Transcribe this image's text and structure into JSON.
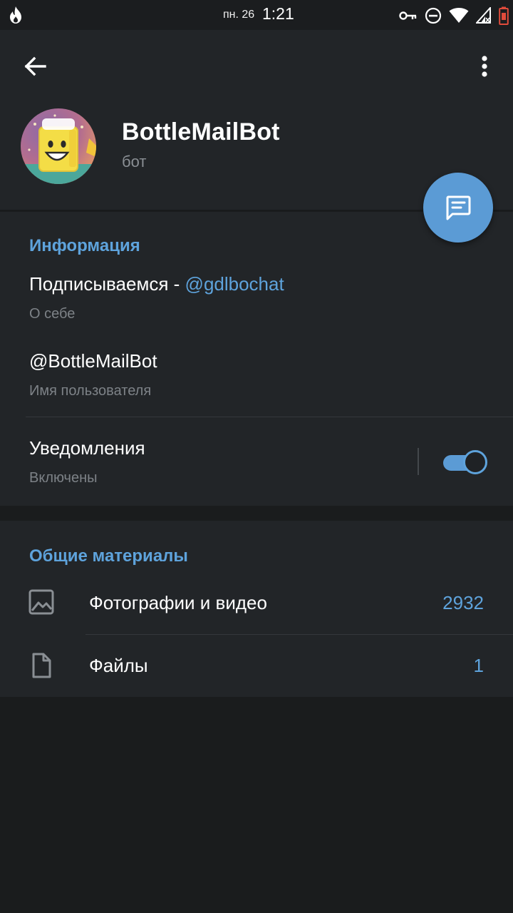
{
  "statusbar": {
    "date": "пн. 26",
    "time": "1:21"
  },
  "bot": {
    "name": "BottleMailBot",
    "subtitle": "бот"
  },
  "info": {
    "section_title": "Информация",
    "about_text": "Подписываемся - ",
    "about_link": "@gdlbochat",
    "about_label": "О себе",
    "username": "@BottleMailBot",
    "username_label": "Имя пользователя",
    "notifications_title": "Уведомления",
    "notifications_status": "Включены",
    "notifications_on": true
  },
  "shared": {
    "section_title": "Общие материалы",
    "items": [
      {
        "label": "Фотографии и видео",
        "count": "2932",
        "icon": "image-icon"
      },
      {
        "label": "Файлы",
        "count": "1",
        "icon": "file-icon"
      }
    ]
  },
  "colors": {
    "accent": "#5ea3dc",
    "fab": "#5b9bd5",
    "background": "#1a1c1d",
    "card": "#222528"
  }
}
